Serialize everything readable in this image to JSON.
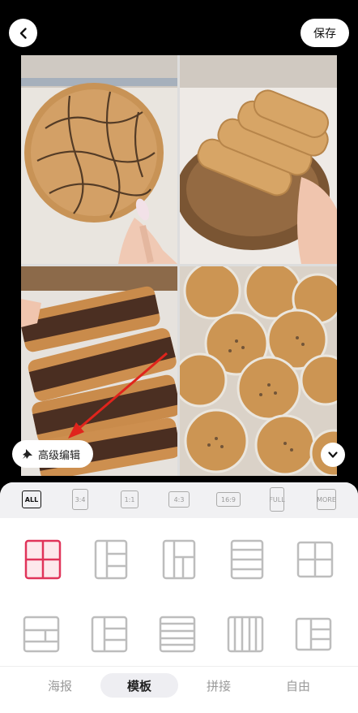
{
  "topbar": {
    "save_label": "保存"
  },
  "edit": {
    "advanced_label": "高级编辑"
  },
  "ratios": [
    "ALL",
    "3:4",
    "1:1",
    "4:3",
    "16:9",
    "FULL",
    "MORE"
  ],
  "tabs": [
    "海报",
    "模板",
    "拼接",
    "自由"
  ],
  "colors": {
    "accent": "#e0345a",
    "panel_bg": "#ffffff",
    "ratio_bar_bg": "#f1f1f3"
  }
}
